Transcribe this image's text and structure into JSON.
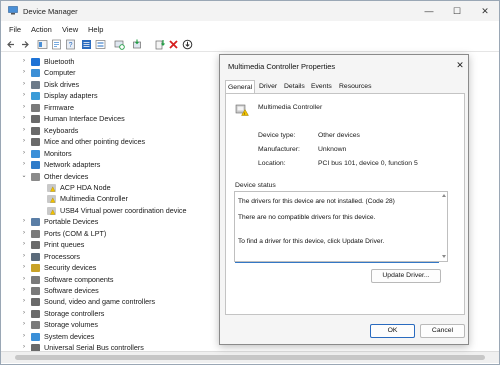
{
  "window": {
    "title": "Device Manager",
    "minimize": "—",
    "maximize": "☐",
    "close": "✕"
  },
  "menu": [
    "File",
    "Action",
    "View",
    "Help"
  ],
  "tree": {
    "items": [
      {
        "label": "Bluetooth",
        "icon": "bluetooth-icon",
        "color": "#1e73d6",
        "expanded": false,
        "indent": 0
      },
      {
        "label": "Computer",
        "icon": "computer-icon",
        "color": "#3c8fd6",
        "expanded": false,
        "indent": 0
      },
      {
        "label": "Disk drives",
        "icon": "disk-icon",
        "color": "#6c7a89",
        "expanded": false,
        "indent": 0
      },
      {
        "label": "Display adapters",
        "icon": "display-icon",
        "color": "#3a9bd8",
        "expanded": false,
        "indent": 0
      },
      {
        "label": "Firmware",
        "icon": "firmware-icon",
        "color": "#7a7a7a",
        "expanded": false,
        "indent": 0
      },
      {
        "label": "Human Interface Devices",
        "icon": "hid-icon",
        "color": "#6a6a6a",
        "expanded": false,
        "indent": 0
      },
      {
        "label": "Keyboards",
        "icon": "keyboard-icon",
        "color": "#6a6a6a",
        "expanded": false,
        "indent": 0
      },
      {
        "label": "Mice and other pointing devices",
        "icon": "mouse-icon",
        "color": "#6a6a6a",
        "expanded": false,
        "indent": 0
      },
      {
        "label": "Monitors",
        "icon": "monitor-icon",
        "color": "#3a8fd8",
        "expanded": false,
        "indent": 0
      },
      {
        "label": "Network adapters",
        "icon": "network-icon",
        "color": "#2e7bc9",
        "expanded": false,
        "indent": 0
      },
      {
        "label": "Other devices",
        "icon": "other-devices-icon",
        "color": "#8a8a8a",
        "expanded": true,
        "indent": 0
      },
      {
        "label": "ACP HDA Node",
        "icon": "warning-device-icon",
        "color": "#9a9a9a",
        "expanded": null,
        "indent": 1
      },
      {
        "label": "Multimedia Controller",
        "icon": "warning-device-icon",
        "color": "#9a9a9a",
        "expanded": null,
        "indent": 1
      },
      {
        "label": "USB4 Virtual power coordination device",
        "icon": "warning-device-icon",
        "color": "#9a9a9a",
        "expanded": null,
        "indent": 1
      },
      {
        "label": "Portable Devices",
        "icon": "portable-icon",
        "color": "#5a7ea6",
        "expanded": false,
        "indent": 0
      },
      {
        "label": "Ports (COM & LPT)",
        "icon": "port-icon",
        "color": "#7a7a7a",
        "expanded": false,
        "indent": 0
      },
      {
        "label": "Print queues",
        "icon": "printer-icon",
        "color": "#6a6a6a",
        "expanded": false,
        "indent": 0
      },
      {
        "label": "Processors",
        "icon": "processor-icon",
        "color": "#5b6b7b",
        "expanded": false,
        "indent": 0
      },
      {
        "label": "Security devices",
        "icon": "security-icon",
        "color": "#c9a227",
        "expanded": false,
        "indent": 0
      },
      {
        "label": "Software components",
        "icon": "software-icon",
        "color": "#7a7a7a",
        "expanded": false,
        "indent": 0
      },
      {
        "label": "Software devices",
        "icon": "software-device-icon",
        "color": "#7a7a7a",
        "expanded": false,
        "indent": 0
      },
      {
        "label": "Sound, video and game controllers",
        "icon": "sound-icon",
        "color": "#6a6a6a",
        "expanded": false,
        "indent": 0
      },
      {
        "label": "Storage controllers",
        "icon": "storage-controller-icon",
        "color": "#6a6a6a",
        "expanded": false,
        "indent": 0
      },
      {
        "label": "Storage volumes",
        "icon": "storage-volume-icon",
        "color": "#7a7a7a",
        "expanded": false,
        "indent": 0
      },
      {
        "label": "System devices",
        "icon": "system-icon",
        "color": "#3a8fd8",
        "expanded": false,
        "indent": 0
      },
      {
        "label": "Universal Serial Bus controllers",
        "icon": "usb-icon",
        "color": "#6a6a6a",
        "expanded": false,
        "indent": 0
      }
    ]
  },
  "dialog": {
    "title": "Multimedia Controller Properties",
    "close": "✕",
    "tabs": [
      "General",
      "Driver",
      "Details",
      "Events",
      "Resources"
    ],
    "active_tab": "General",
    "device_name": "Multimedia Controller",
    "device_type_label": "Device type:",
    "device_type_value": "Other devices",
    "manufacturer_label": "Manufacturer:",
    "manufacturer_value": "Unknown",
    "location_label": "Location:",
    "location_value": "PCI bus 101, device 0, function 5",
    "status_legend": "Device status",
    "status_lines": [
      "The drivers for this device are not installed. (Code 28)",
      "There are no compatible drivers for this device.",
      "To find a driver for this device, click Update Driver."
    ],
    "update_driver": "Update Driver...",
    "ok": "OK",
    "cancel": "Cancel"
  },
  "colors": {
    "accent": "#2a6bbf",
    "warning": "#f2c200",
    "error": "#d61f1f",
    "green": "#1f9d43"
  }
}
